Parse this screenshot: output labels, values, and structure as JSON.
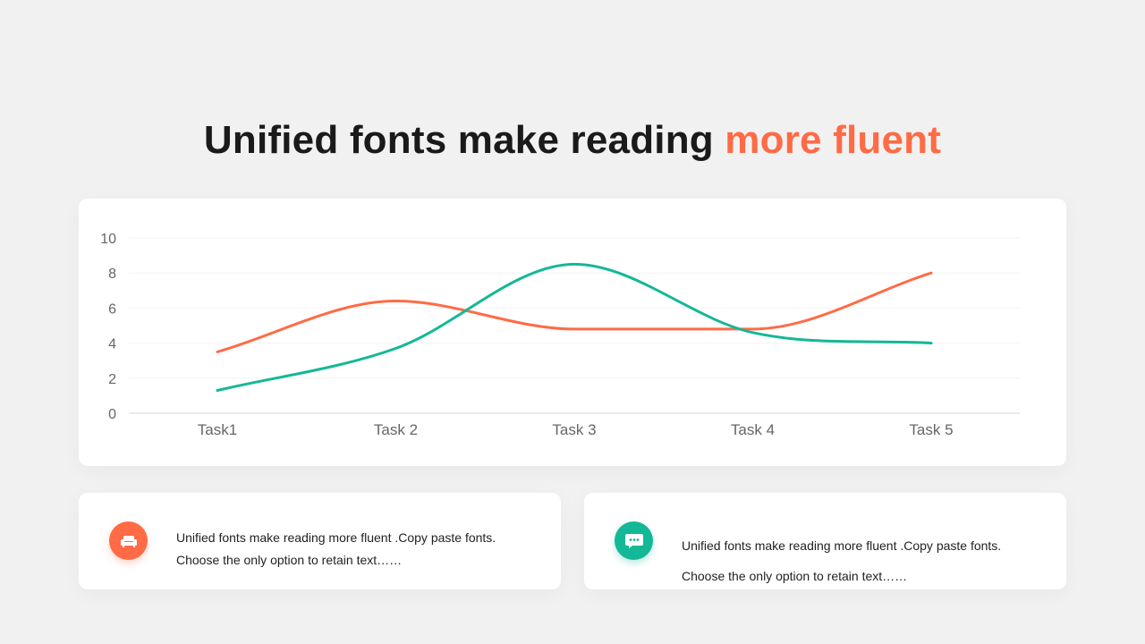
{
  "header": {
    "title_main": "Unified fonts make reading ",
    "title_accent": "more fluent"
  },
  "colors": {
    "accent": "#ff6b45",
    "teal": "#14b896",
    "background": "#f1f1f1"
  },
  "chart_data": {
    "type": "line",
    "title": "",
    "xlabel": "",
    "ylabel": "",
    "categories": [
      "Task1",
      "Task 2",
      "Task 3",
      "Task 4",
      "Task 5"
    ],
    "ylim": [
      0,
      10
    ],
    "yticks": [
      0,
      2,
      4,
      6,
      8,
      10
    ],
    "grid": true,
    "legend": "none",
    "series": [
      {
        "color": "#ff6b45",
        "values": [
          3.5,
          6.4,
          4.8,
          4.8,
          8.0
        ]
      },
      {
        "color": "#14b896",
        "values": [
          1.3,
          3.7,
          8.5,
          4.6,
          4.0
        ]
      }
    ]
  },
  "cards": [
    {
      "icon": "sofa-icon",
      "color": "#ff6b45",
      "line1": "Unified fonts make reading more fluent .Copy  paste fonts.",
      "line2": "Choose the only option to retain text……"
    },
    {
      "icon": "chat-bubble-icon",
      "color": "#14b896",
      "line1": "Unified fonts make reading more fluent .Copy  paste fonts.",
      "line2": "Choose the only option to retain text……"
    }
  ]
}
